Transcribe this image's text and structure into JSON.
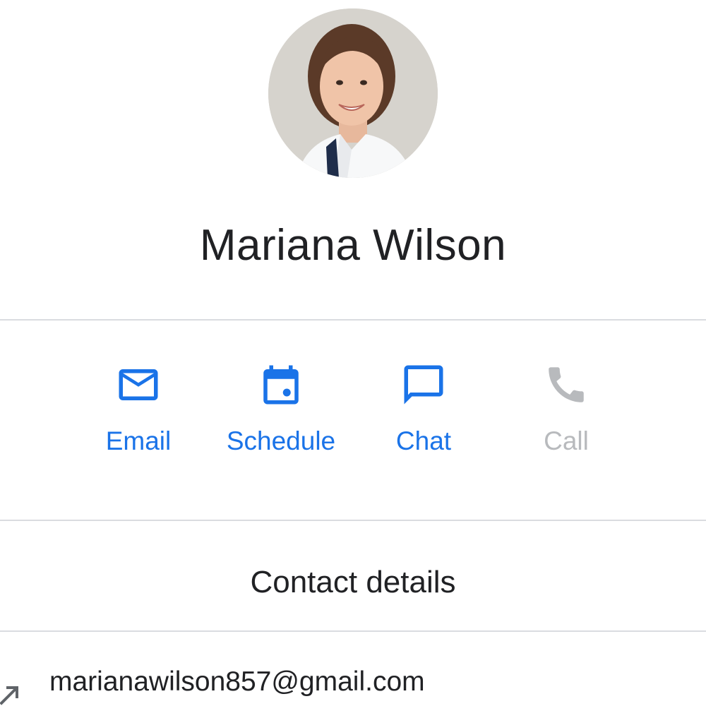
{
  "contact": {
    "name": "Mariana Wilson",
    "avatar_icon": "profile-photo"
  },
  "actions": {
    "email": {
      "label": "Email",
      "icon": "mail-icon",
      "enabled": true
    },
    "schedule": {
      "label": "Schedule",
      "icon": "calendar-icon",
      "enabled": true
    },
    "chat": {
      "label": "Chat",
      "icon": "chat-bubble-icon",
      "enabled": true
    },
    "call": {
      "label": "Call",
      "icon": "phone-icon",
      "enabled": false
    }
  },
  "details": {
    "title": "Contact details",
    "email": "marianawilson857@gmail.com",
    "email_icon": "open-external-icon"
  },
  "colors": {
    "accent": "#1a73e8",
    "disabled": "#b8babd",
    "text": "#202124",
    "divider": "#dadce0"
  }
}
